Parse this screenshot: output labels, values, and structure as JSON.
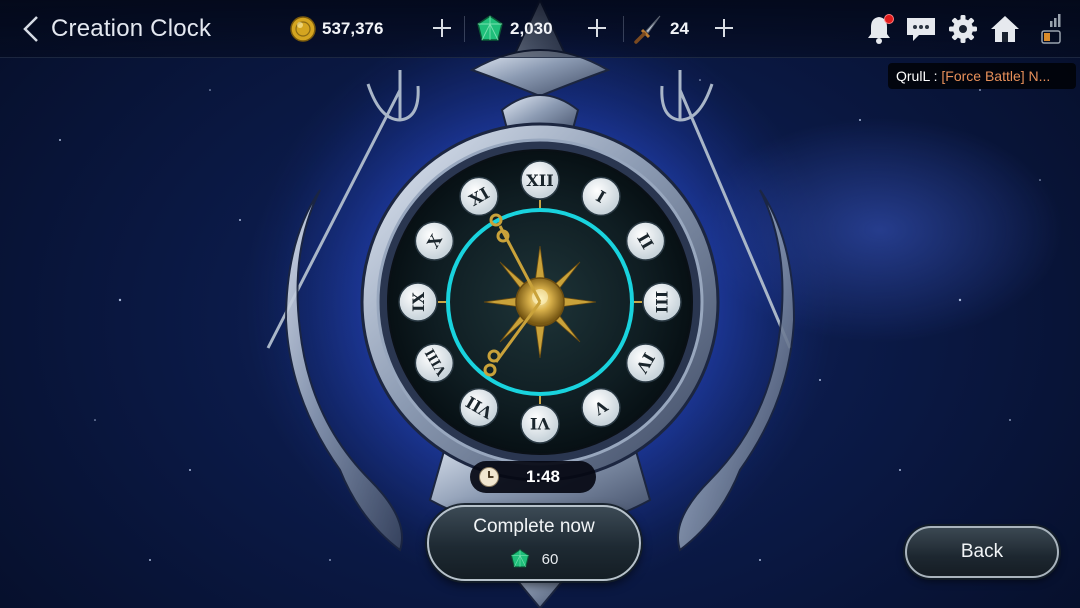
{
  "header": {
    "title": "Creation Clock",
    "gold": "537,376",
    "gems": "2,030",
    "daggers": "24"
  },
  "chat": {
    "sender": "QrulL : ",
    "message": "[Force Battle] N..."
  },
  "clock": {
    "numerals": [
      "XII",
      "I",
      "II",
      "III",
      "IV",
      "V",
      "VI",
      "VII",
      "VIII",
      "IX",
      "X",
      "XI"
    ]
  },
  "timer": {
    "remaining": "1:48"
  },
  "actions": {
    "complete_label": "Complete now",
    "complete_cost": "60",
    "back_label": "Back"
  },
  "colors": {
    "accent_ring": "#19d3de",
    "chat_message": "#e8905a",
    "notification": "#e21b1b",
    "gem": "#1fbf7a",
    "gold": "#d4a520"
  },
  "icons": [
    "back-chevron-icon",
    "gold-coin-icon",
    "gem-icon",
    "dagger-icon",
    "plus-icon",
    "bell-icon",
    "chat-icon",
    "gear-icon",
    "home-icon",
    "signal-battery-icon",
    "clock-icon"
  ]
}
